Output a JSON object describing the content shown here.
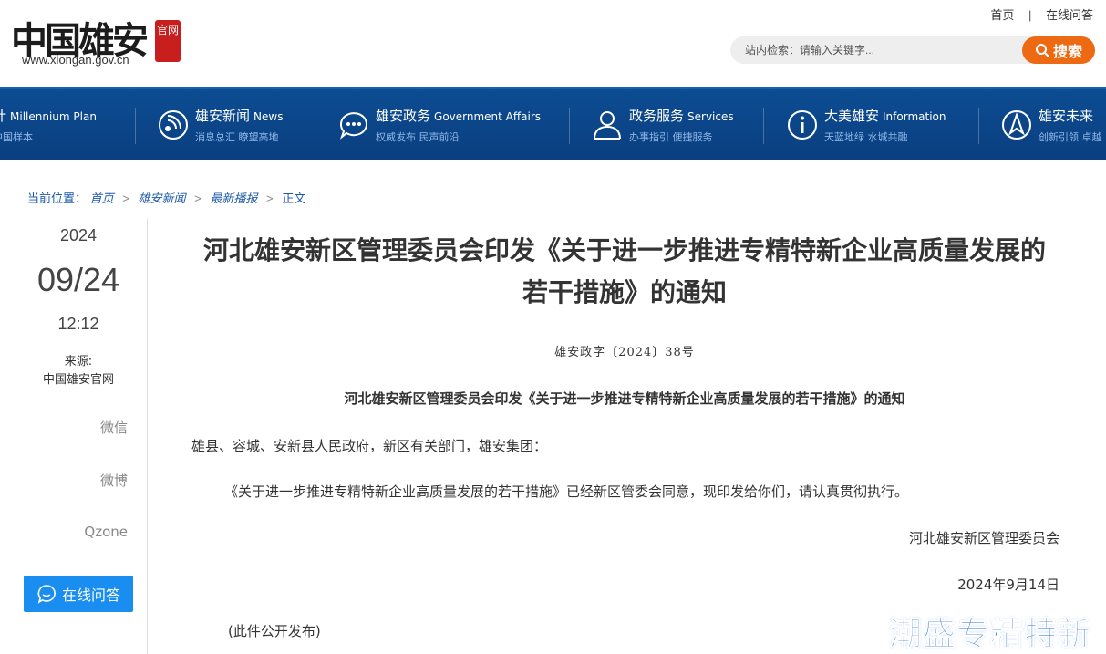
{
  "header": {
    "logo_text": "中国雄安",
    "logo_seal": "官网",
    "logo_url": "www.xiongan.gov.cn",
    "toplinks": {
      "home": "首页",
      "separator": "|",
      "qa": "在线问答"
    },
    "search": {
      "placeholder": "站内检索：请输入关键字...",
      "button_label": "搜索"
    }
  },
  "nav": {
    "items": [
      {
        "title": "计",
        "en": "Millennium Plan",
        "sub": "中国样本",
        "icon": "plan-icon"
      },
      {
        "title": "雄安新闻",
        "en": "News",
        "sub": "消息总汇 瞭望高地",
        "icon": "news-icon"
      },
      {
        "title": "雄安政务",
        "en": "Government Affairs",
        "sub": "权威发布 民声前沿",
        "icon": "government-icon"
      },
      {
        "title": "政务服务",
        "en": "Services",
        "sub": "办事指引 便捷服务",
        "icon": "services-icon"
      },
      {
        "title": "大美雄安",
        "en": "Information",
        "sub": "天蓝地绿 水城共融",
        "icon": "info-icon"
      },
      {
        "title": "雄安未来",
        "en": "",
        "sub": "创新引领 卓越",
        "icon": "future-icon"
      }
    ]
  },
  "breadcrumb": {
    "label": "当前位置：",
    "items": [
      "首页",
      "雄安新闻",
      "最新播报"
    ],
    "arrow": ">",
    "current": "正文"
  },
  "meta": {
    "year": "2024",
    "month_day": "09/24",
    "time": "12:12",
    "source_label": "来源:",
    "source": "中国雄安官网",
    "share": [
      "微信",
      "微博",
      "Qzone"
    ],
    "qa_button": "在线问答"
  },
  "article": {
    "title": "河北雄安新区管理委员会印发《关于进一步推进专精特新企业高质量发展的若干措施》的通知",
    "doc_number": "雄安政字〔2024〕38号",
    "subtitle": "河北雄安新区管理委员会印发《关于进一步推进专精特新企业高质量发展的若干措施》的通知",
    "recipients": "雄县、容城、安新县人民政府，新区有关部门，雄安集团：",
    "body": "《关于进一步推进专精特新企业高质量发展的若干措施》已经新区管委会同意，现印发给你们，请认真贯彻执行。",
    "signature": "河北雄安新区管理委员会",
    "date": "2024年9月14日",
    "note": "(此件公开发布)"
  },
  "banner": {
    "text": "潮盛专精特新"
  },
  "colors": {
    "nav_bg": "#0d4c92",
    "search_button": "#ee6a12",
    "qa_button": "#1a8ef0",
    "link": "#1e5aa8",
    "seal": "#c81e1e",
    "banner": "#2b6fd6"
  }
}
